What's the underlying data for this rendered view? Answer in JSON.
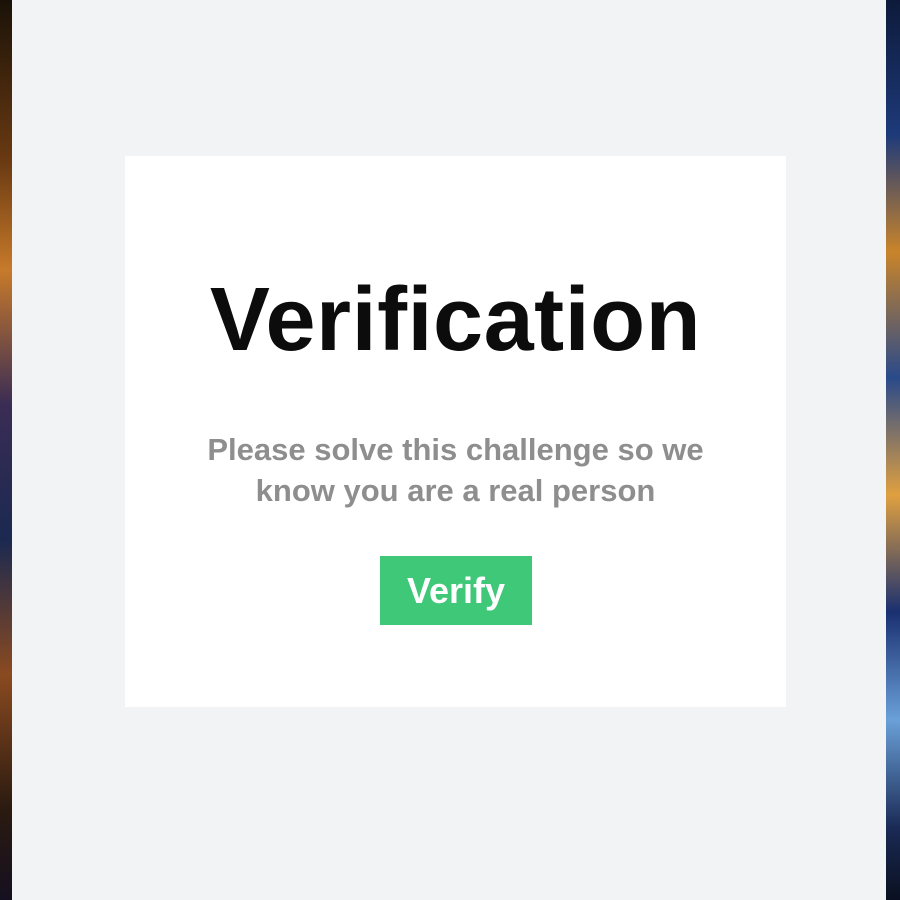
{
  "verification": {
    "title": "Verification",
    "message": "Please solve this challenge so we know you are a real person",
    "button_label": "Verify"
  },
  "colors": {
    "overlay_background": "#f2f3f5",
    "card_background": "#ffffff",
    "title_text": "#0c0c0c",
    "message_text": "#8e8e8e",
    "button_background": "#3ec878",
    "button_text": "#ffffff"
  }
}
